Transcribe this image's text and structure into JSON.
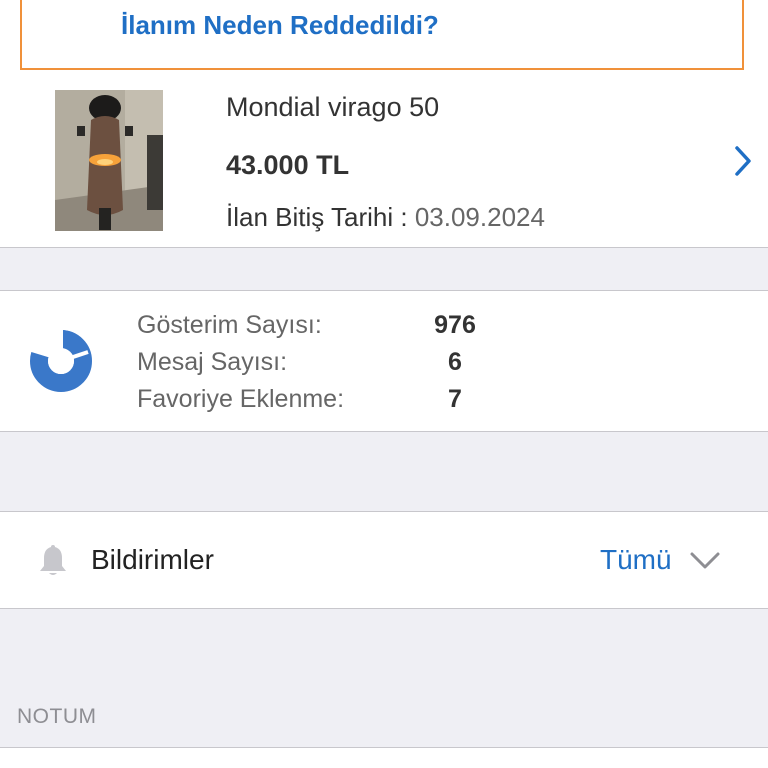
{
  "rejection": {
    "link_text": "İlanım Neden Reddedildi?"
  },
  "listing": {
    "title": "Mondial virago 50",
    "price": "43.000 TL",
    "expiry_label": "İlan Bitiş Tarihi :",
    "expiry_date": "03.09.2024"
  },
  "stats": {
    "items": [
      {
        "label": "Gösterim Sayısı:",
        "value": "976"
      },
      {
        "label": "Mesaj Sayısı:",
        "value": "6"
      },
      {
        "label": "Favoriye Eklenme:",
        "value": "7"
      }
    ]
  },
  "notifications": {
    "title": "Bildirimler",
    "filter_value": "Tümü"
  },
  "notes": {
    "header": "NOTUM"
  },
  "colors": {
    "accent_blue": "#1f6fc5",
    "warning_orange": "#f0913a",
    "background_gray": "#efeff4"
  },
  "icons": {
    "stats": "pie-chart-icon",
    "detail": "chevron-right-icon",
    "notifications": "bell-icon",
    "filter": "chevron-down-icon"
  }
}
